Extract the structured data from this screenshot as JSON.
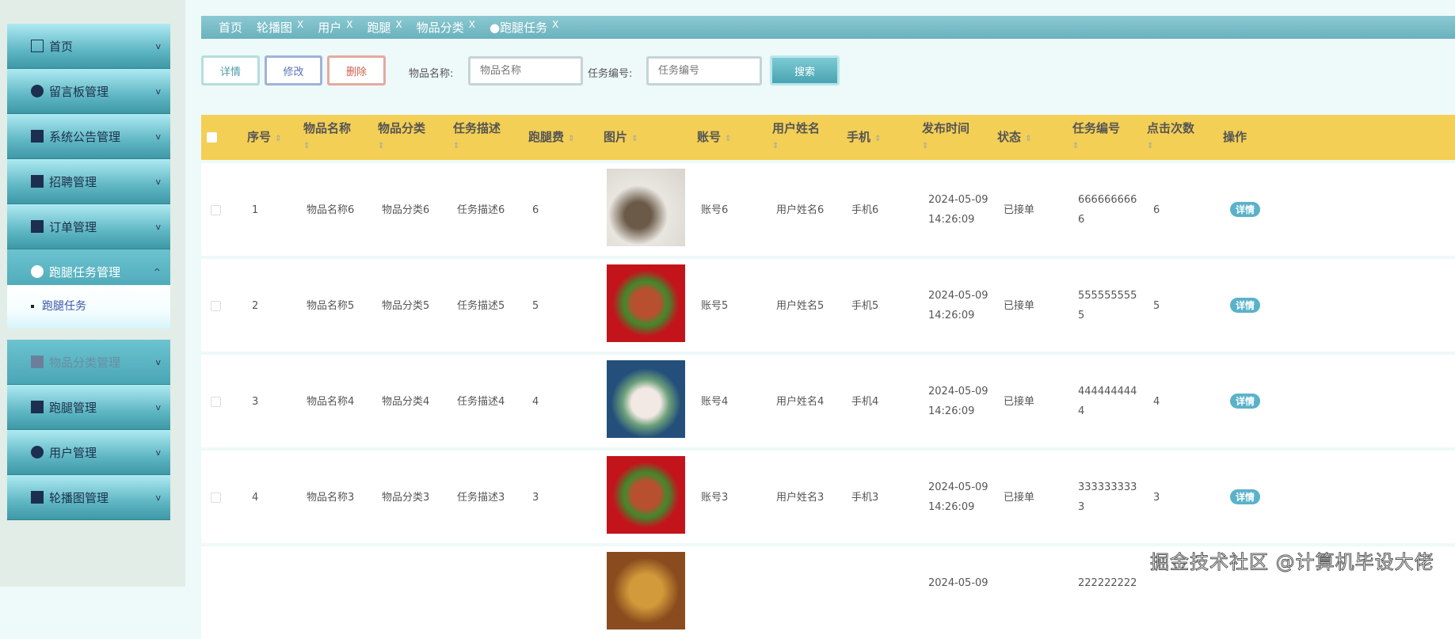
{
  "sidebar": {
    "items": [
      {
        "label": "首页",
        "icon": "home-icon"
      },
      {
        "label": "留言板管理",
        "icon": "chat-icon"
      },
      {
        "label": "系统公告管理",
        "icon": "grid-icon"
      },
      {
        "label": "招聘管理",
        "icon": "building-icon"
      },
      {
        "label": "订单管理",
        "icon": "card-icon"
      },
      {
        "label": "跑腿任务管理",
        "icon": "drop-icon"
      },
      {
        "label": "物品分类管理",
        "icon": "card-icon"
      },
      {
        "label": "跑腿管理",
        "icon": "person-icon"
      },
      {
        "label": "用户管理",
        "icon": "user-icon"
      },
      {
        "label": "轮播图管理",
        "icon": "image-icon"
      }
    ],
    "submenu": "跑腿任务"
  },
  "tabs": [
    {
      "label": "首页"
    },
    {
      "label": "轮播图"
    },
    {
      "label": "用户"
    },
    {
      "label": "跑腿"
    },
    {
      "label": "物品分类"
    },
    {
      "label": "●跑腿任务"
    }
  ],
  "tab_close": "X",
  "toolbar": {
    "detail": "详情",
    "edit": "修改",
    "delete": "删除",
    "name_label": "物品名称:",
    "name_placeholder": "物品名称",
    "code_label": "任务编号:",
    "code_placeholder": "任务编号",
    "search": "搜索"
  },
  "columns": [
    "序号",
    "物品名称",
    "物品分类",
    "任务描述",
    "跑腿费",
    "图片",
    "账号",
    "用户姓名",
    "手机",
    "发布时间",
    "状态",
    "任务编号",
    "点击次数",
    "操作"
  ],
  "sort_glyph": "⇕",
  "rows": [
    {
      "no": "1",
      "name": "物品名称6",
      "cat": "物品分类6",
      "desc": "任务描述6",
      "fee": "6",
      "acct": "账号6",
      "user": "用户姓名6",
      "phone": "手机6",
      "date": "2024-05-09",
      "time": "14:26:09",
      "status": "已接单",
      "code1": "666666666",
      "code2": "6",
      "clicks": "6",
      "action": "详情"
    },
    {
      "no": "2",
      "name": "物品名称5",
      "cat": "物品分类5",
      "desc": "任务描述5",
      "fee": "5",
      "acct": "账号5",
      "user": "用户姓名5",
      "phone": "手机5",
      "date": "2024-05-09",
      "time": "14:26:09",
      "status": "已接单",
      "code1": "555555555",
      "code2": "5",
      "clicks": "5",
      "action": "详情"
    },
    {
      "no": "3",
      "name": "物品名称4",
      "cat": "物品分类4",
      "desc": "任务描述4",
      "fee": "4",
      "acct": "账号4",
      "user": "用户姓名4",
      "phone": "手机4",
      "date": "2024-05-09",
      "time": "14:26:09",
      "status": "已接单",
      "code1": "444444444",
      "code2": "4",
      "clicks": "4",
      "action": "详情"
    },
    {
      "no": "4",
      "name": "物品名称3",
      "cat": "物品分类3",
      "desc": "任务描述3",
      "fee": "3",
      "acct": "账号3",
      "user": "用户姓名3",
      "phone": "手机3",
      "date": "2024-05-09",
      "time": "14:26:09",
      "status": "已接单",
      "code1": "333333333",
      "code2": "3",
      "clicks": "3",
      "action": "详情"
    },
    {
      "date": "2024-05-09",
      "code1": "222222222"
    }
  ],
  "watermark": "掘金技术社区 @计算机毕设大佬"
}
